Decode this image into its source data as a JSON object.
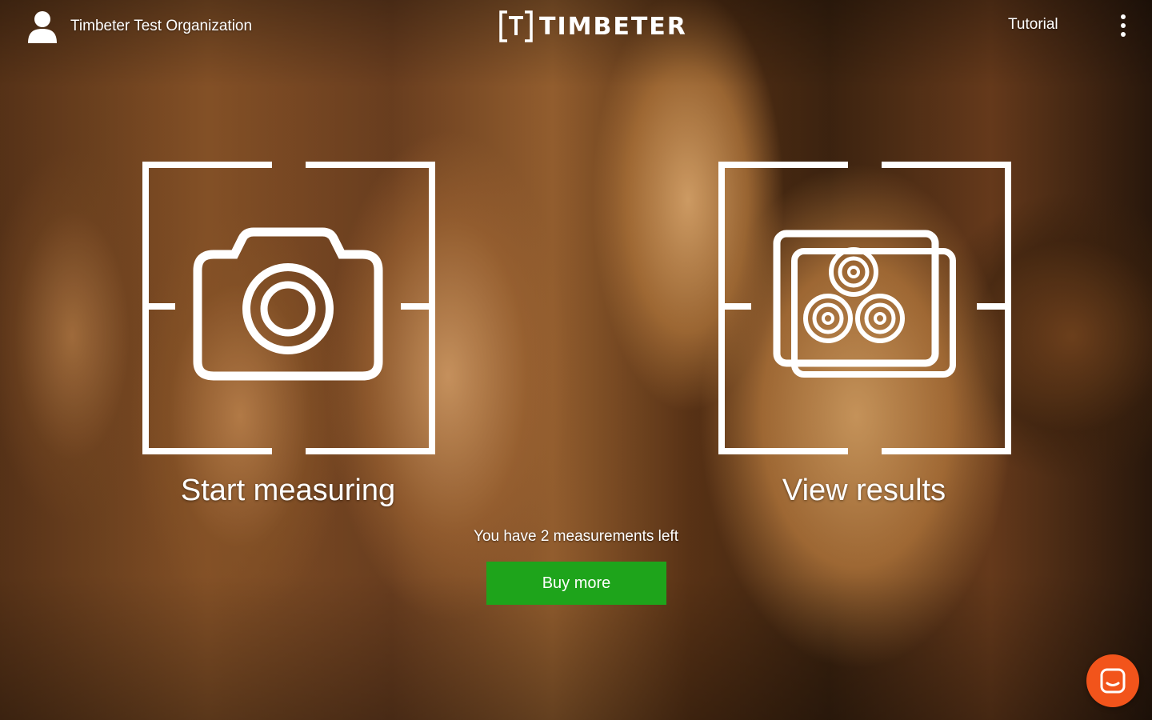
{
  "header": {
    "organization_name": "Timbeter Test Organization",
    "logo_text": "TIMBETER",
    "tutorial_label": "Tutorial",
    "user_icon": "user-icon",
    "menu_icon": "more-vertical-icon"
  },
  "actions": {
    "start_measuring_label": "Start measuring",
    "start_measuring_icon": "camera-icon",
    "view_results_label": "View results",
    "view_results_icon": "log-stack-photos-icon"
  },
  "measurements": {
    "remaining_text": "You have 2 measurements left",
    "buy_more_label": "Buy more"
  },
  "chat": {
    "icon": "chat-icon"
  },
  "colors": {
    "buy_button": "#1ea41b",
    "chat_button": "#f2541b",
    "foreground": "#ffffff"
  }
}
